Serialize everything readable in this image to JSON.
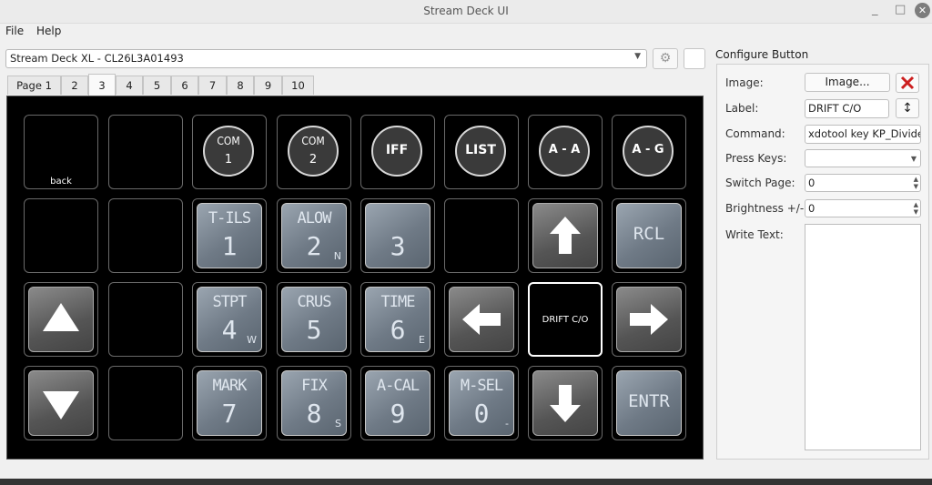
{
  "window": {
    "title": "Stream Deck UI",
    "minimize": "_",
    "maximize": "□",
    "close": "✕"
  },
  "menu": {
    "file": "File",
    "help": "Help"
  },
  "device": {
    "selected": "Stream Deck XL - CL26L3A01493"
  },
  "tabs": [
    "Page 1",
    "2",
    "3",
    "4",
    "5",
    "6",
    "7",
    "8",
    "9",
    "10"
  ],
  "active_tab": "3",
  "deck": {
    "row1": {
      "k1": "back",
      "k3": {
        "top": "COM",
        "bottom": "1"
      },
      "k4": {
        "top": "COM",
        "bottom": "2"
      },
      "k5": "IFF",
      "k6": "LIST",
      "k7": "A - A",
      "k8": "A - G"
    },
    "row2": {
      "k3": {
        "top": "T-ILS",
        "big": "1",
        "sub": ""
      },
      "k4": {
        "top": "ALOW",
        "big": "2",
        "sub": "N"
      },
      "k5": {
        "top": "",
        "big": "3",
        "sub": ""
      },
      "k7": "up-arrow-icon",
      "k8": "RCL"
    },
    "row3": {
      "k1": "up-triangle-icon",
      "k3": {
        "top": "STPT",
        "big": "4",
        "sub": "W"
      },
      "k4": {
        "top": "CRUS",
        "big": "5",
        "sub": ""
      },
      "k5": {
        "top": "TIME",
        "big": "6",
        "sub": "E"
      },
      "k6": "left-arrow-icon",
      "k7": "DRIFT C/O",
      "k8": "right-arrow-icon"
    },
    "row4": {
      "k1": "down-triangle-icon",
      "k3": {
        "top": "MARK",
        "big": "7",
        "sub": ""
      },
      "k4": {
        "top": "FIX",
        "big": "8",
        "sub": "S"
      },
      "k5": {
        "top": "A-CAL",
        "big": "9",
        "sub": ""
      },
      "k6": {
        "top": "M-SEL",
        "big": "0",
        "sub": "-"
      },
      "k7": "down-arrow-icon",
      "k8": "ENTR"
    }
  },
  "config": {
    "title": "Configure Button",
    "image_label": "Image:",
    "image_button": "Image...",
    "label_label": "Label:",
    "label_value": "DRIFT C/O",
    "command_label": "Command:",
    "command_value": "xdotool key KP_Divide",
    "presskeys_label": "Press Keys:",
    "presskeys_value": "",
    "switchpage_label": "Switch Page:",
    "switchpage_value": "0",
    "brightness_label": "Brightness +/-:",
    "brightness_value": "0",
    "writetext_label": "Write Text:",
    "writetext_value": ""
  },
  "colors": {
    "delete_red": "#cc1f1f",
    "deck_bg": "#000000"
  }
}
